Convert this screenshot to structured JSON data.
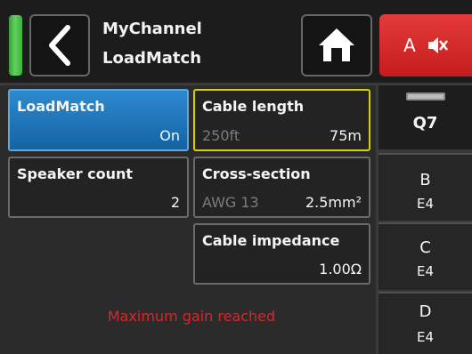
{
  "header": {
    "title_line1": "MyChannel",
    "title_line2": "LoadMatch",
    "mute_label": "A"
  },
  "tiles": {
    "loadmatch": {
      "label": "LoadMatch",
      "value": "On"
    },
    "cable_length": {
      "label": "Cable length",
      "sub": "250ft",
      "value": "75m"
    },
    "speaker_count": {
      "label": "Speaker count",
      "value": "2"
    },
    "cross_section": {
      "label": "Cross-section",
      "sub": "AWG 13",
      "value": "2.5mm²"
    },
    "cable_impedance": {
      "label": "Cable impedance",
      "value": "1.00Ω"
    }
  },
  "warning": "Maximum gain reached",
  "channels": [
    {
      "name": "Q7"
    },
    {
      "name": "B",
      "code": "E4"
    },
    {
      "name": "C",
      "code": "E4"
    },
    {
      "name": "D",
      "code": "E4"
    }
  ],
  "colors": {
    "status_led": "#4ccf4c",
    "mute_button": "#d42828",
    "active_tile": "#1f78be",
    "selected_border": "#d6d200",
    "warning_text": "#d12a2a"
  },
  "icons": {
    "back": "chevron-left-icon",
    "home": "home-icon",
    "mute": "speaker-muted-icon"
  }
}
